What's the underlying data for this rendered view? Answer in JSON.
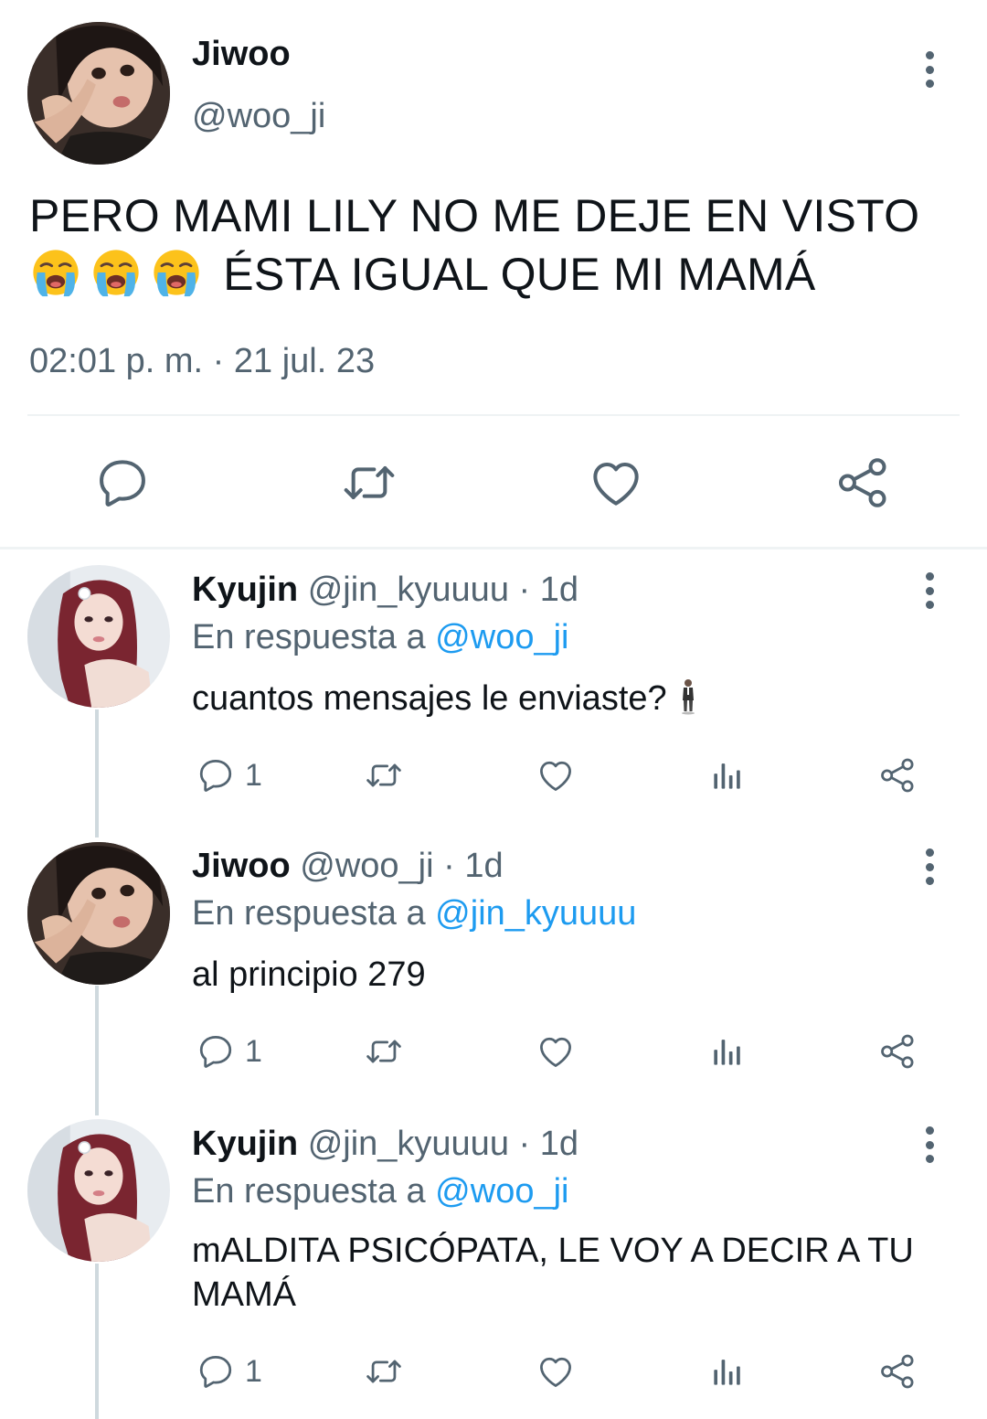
{
  "main_tweet": {
    "name": "Jiwoo",
    "handle": "@woo_ji",
    "text_line1": "PERO MAMI LILY NO ME DEJE EN VISTO",
    "text_line2": "ÉSTA IGUAL QUE MI MAMÁ",
    "emojis": [
      "loudly-crying-face",
      "loudly-crying-face",
      "loudly-crying-face"
    ],
    "timestamp": "02:01 p. m. · 21 jul. 23",
    "actions": [
      "reply-icon",
      "retweet-icon",
      "like-icon",
      "share-icon"
    ]
  },
  "replies": [
    {
      "name": "Kyujin",
      "handle": "@jin_kyuuuu · 1d",
      "reply_prefix": "En respuesta a",
      "reply_mention": "@woo_ji",
      "text": "cuantos mensajes le enviaste?",
      "trailing_emoji": "man-in-business-suit-levitating",
      "reply_count": "1"
    },
    {
      "name": "Jiwoo",
      "handle": "@woo_ji · 1d",
      "reply_prefix": "En respuesta a",
      "reply_mention": "@jin_kyuuuu",
      "text": "al principio 279",
      "reply_count": "1"
    },
    {
      "name": "Kyujin",
      "handle": "@jin_kyuuuu · 1d",
      "reply_prefix": "En respuesta a",
      "reply_mention": "@woo_ji",
      "text": "mALDITA PSICÓPATA, LE VOY A DECIR A TU MAMÁ",
      "reply_count": "1"
    }
  ],
  "colors": {
    "text": "#0f1419",
    "secondary": "#536471",
    "mention": "#1d9bf0",
    "divider": "#eff3f4",
    "thread_line": "#cfd9de"
  }
}
